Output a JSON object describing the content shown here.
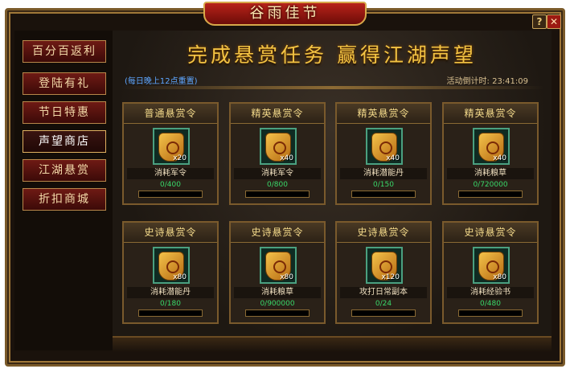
{
  "window": {
    "title": "谷雨佳节",
    "help_label": "?",
    "close_label": "✕"
  },
  "sidebar": {
    "items": [
      {
        "label": "百分百返利",
        "active": false
      },
      {
        "label": "登陆有礼",
        "active": false
      },
      {
        "label": "节日特惠",
        "active": false
      },
      {
        "label": "声望商店",
        "active": true
      },
      {
        "label": "江湖悬赏",
        "active": false
      },
      {
        "label": "折扣商城",
        "active": false
      }
    ]
  },
  "header": {
    "title": "完成悬赏任务  赢得江湖声望",
    "note": "(每日晚上12点重置)",
    "timer_label": "活动倒计时:",
    "timer_value": "23:41:09"
  },
  "cards": [
    {
      "title": "普通悬赏令",
      "qty": "x20",
      "label": "消耗军令",
      "progress": "0/400",
      "fill": 0
    },
    {
      "title": "精英悬赏令",
      "qty": "x40",
      "label": "消耗军令",
      "progress": "0/800",
      "fill": 0
    },
    {
      "title": "精英悬赏令",
      "qty": "x40",
      "label": "消耗潜能丹",
      "progress": "0/150",
      "fill": 0
    },
    {
      "title": "精英悬赏令",
      "qty": "x40",
      "label": "消耗粮草",
      "progress": "0/720000",
      "fill": 0
    },
    {
      "title": "史诗悬赏令",
      "qty": "x80",
      "label": "消耗潜能丹",
      "progress": "0/180",
      "fill": 0
    },
    {
      "title": "史诗悬赏令",
      "qty": "x80",
      "label": "消耗粮草",
      "progress": "0/900000",
      "fill": 0
    },
    {
      "title": "史诗悬赏令",
      "qty": "x120",
      "label": "攻打日常副本",
      "progress": "0/24",
      "fill": 0
    },
    {
      "title": "史诗悬赏令",
      "qty": "x80",
      "label": "消耗经验书",
      "progress": "0/480",
      "fill": 0
    }
  ]
}
